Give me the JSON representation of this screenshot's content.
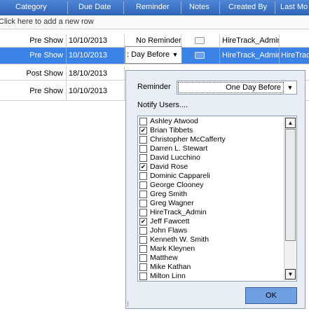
{
  "grid": {
    "columns": [
      "Category",
      "Due Date",
      "Reminder",
      "Notes",
      "Created By",
      "Last Mo"
    ],
    "add_row_text": "Click here to add a new row",
    "rows": [
      {
        "category": "Pre Show",
        "due": "10/10/2013",
        "reminder": "No Reminder",
        "created_by": "HireTrack_Admin",
        "last": ""
      },
      {
        "category": "Pre Show",
        "due": "10/10/2013",
        "reminder": ": Day Before",
        "created_by": "HireTrack_Admin",
        "last": "HireTrac"
      },
      {
        "category": "Post Show",
        "due": "18/10/2013"
      },
      {
        "category": "Pre Show",
        "due": "10/10/2013"
      }
    ]
  },
  "popup": {
    "reminder_label": "Reminder",
    "reminder_value": "One Day Before",
    "notify_label": "Notify Users....",
    "users": [
      {
        "name": "Ashley Atwood",
        "checked": false
      },
      {
        "name": "Brian Tibbets",
        "checked": true
      },
      {
        "name": "Christopher McCafferty",
        "checked": false
      },
      {
        "name": "Darren L. Stewart",
        "checked": false
      },
      {
        "name": "David Lucchino",
        "checked": false
      },
      {
        "name": "David Rose",
        "checked": true
      },
      {
        "name": "Dominic Cappareli",
        "checked": false
      },
      {
        "name": "George Clooney",
        "checked": false
      },
      {
        "name": "Greg Smith",
        "checked": false
      },
      {
        "name": "Greg Wagner",
        "checked": false
      },
      {
        "name": "HireTrack_Admin",
        "checked": false
      },
      {
        "name": "Jeff Fawcett",
        "checked": true
      },
      {
        "name": "John Flaws",
        "checked": false
      },
      {
        "name": "Kenneth W. Smith",
        "checked": false
      },
      {
        "name": "Mark Kleynen",
        "checked": false
      },
      {
        "name": "Matthew",
        "checked": false
      },
      {
        "name": "Mike Kathan",
        "checked": false
      },
      {
        "name": "Milton Linn",
        "checked": false
      }
    ],
    "ok_label": "OK"
  },
  "colors": {
    "header": "#2f64b8",
    "selected_row": "#3b82e6",
    "panel": "#e9edf4",
    "ok_button": "#6f9fe0"
  }
}
